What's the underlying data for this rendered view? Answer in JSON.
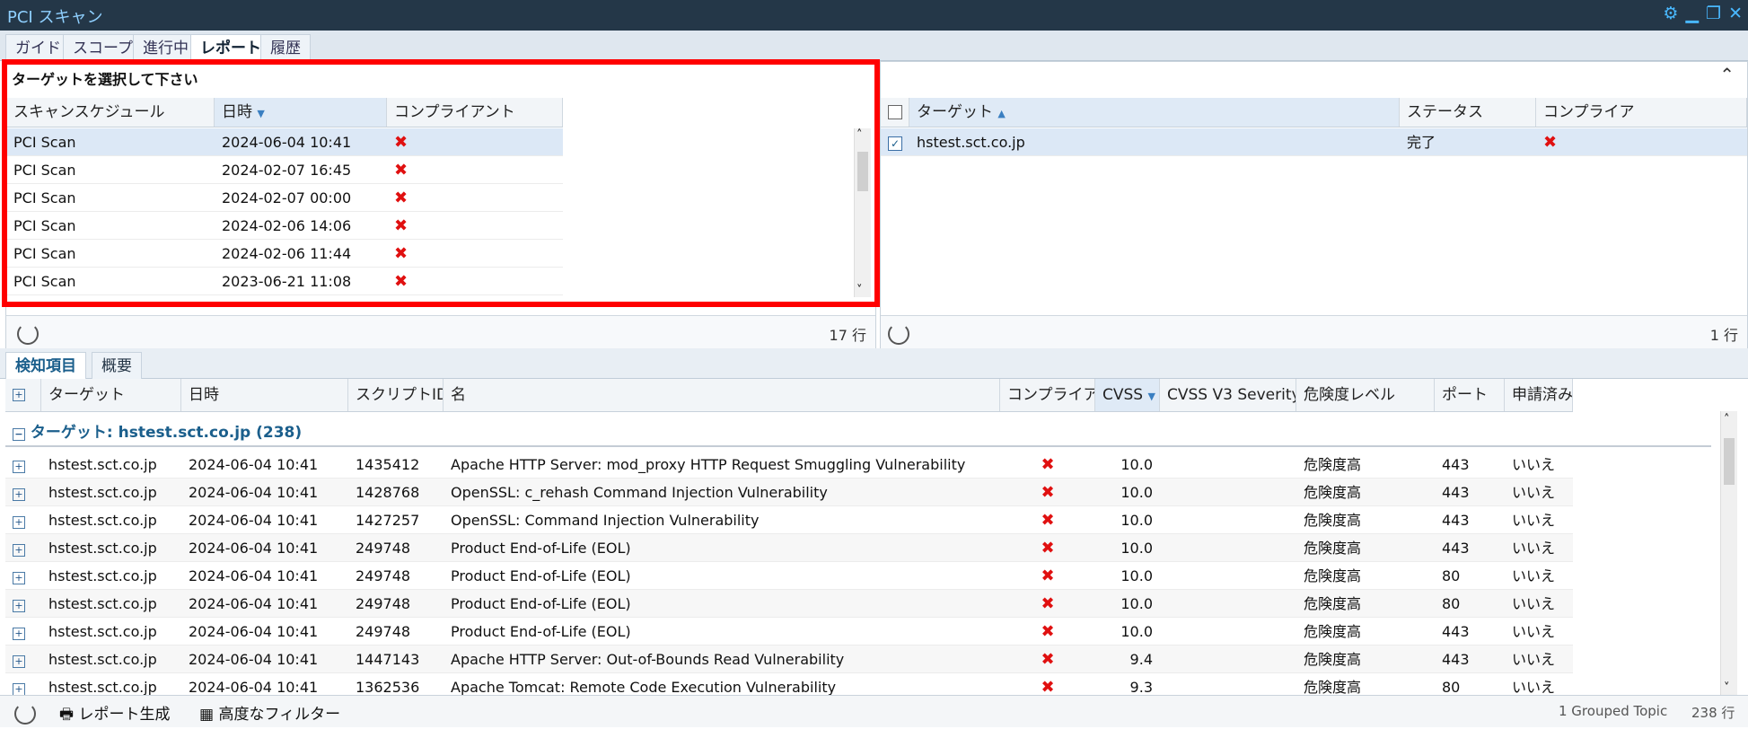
{
  "window": {
    "title": "PCI スキャン",
    "controls": [
      "gear-icon",
      "minimize-icon",
      "restore-icon",
      "close-icon"
    ]
  },
  "main_tabs": [
    "ガイド",
    "スコープ",
    "進行中",
    "レポート",
    "履歴"
  ],
  "active_main_tab": "レポート",
  "left_panel": {
    "title": "ターゲットを選択して下さい",
    "columns": [
      "スキャンスケジュール",
      "日時",
      "コンプライアント"
    ],
    "rows": [
      {
        "schedule": "PCI Scan",
        "datetime": "2024-06-04 10:41",
        "compliant": "✖"
      },
      {
        "schedule": "PCI Scan",
        "datetime": "2024-02-07 16:45",
        "compliant": "✖"
      },
      {
        "schedule": "PCI Scan",
        "datetime": "2024-02-07 00:00",
        "compliant": "✖"
      },
      {
        "schedule": "PCI Scan",
        "datetime": "2024-02-06 14:06",
        "compliant": "✖"
      },
      {
        "schedule": "PCI Scan",
        "datetime": "2024-02-06 11:44",
        "compliant": "✖"
      },
      {
        "schedule": "PCI Scan",
        "datetime": "2023-06-21 11:08",
        "compliant": "✖"
      }
    ],
    "row_count": "17 行"
  },
  "right_panel": {
    "columns": [
      "ターゲット",
      "ステータス",
      "コンプライア"
    ],
    "rows": [
      {
        "target": "hstest.sct.co.jp",
        "status": "完了",
        "compliant": "✖"
      }
    ],
    "row_count": "1 行"
  },
  "sub_tabs": [
    "検知項目",
    "概要"
  ],
  "findings": {
    "columns": [
      "ターゲット",
      "日時",
      "スクリプトID",
      "名",
      "コンプライア",
      "CVSS",
      "CVSS V3 Severity",
      "危険度レベル",
      "ポート",
      "申請済み"
    ],
    "group_label": "ターゲット: hstest.sct.co.jp (238)",
    "rows": [
      {
        "target": "hstest.sct.co.jp",
        "datetime": "2024-06-04 10:41",
        "script_id": "1435412",
        "name": "Apache HTTP Server: mod_proxy HTTP Request Smuggling Vulnerability",
        "compliant": "✖",
        "cvss": "10.0",
        "v3": "",
        "risk": "危険度高",
        "port": "443",
        "applied": "いいえ"
      },
      {
        "target": "hstest.sct.co.jp",
        "datetime": "2024-06-04 10:41",
        "script_id": "1428768",
        "name": "OpenSSL: c_rehash Command Injection Vulnerability",
        "compliant": "✖",
        "cvss": "10.0",
        "v3": "",
        "risk": "危険度高",
        "port": "443",
        "applied": "いいえ"
      },
      {
        "target": "hstest.sct.co.jp",
        "datetime": "2024-06-04 10:41",
        "script_id": "1427257",
        "name": "OpenSSL: Command Injection Vulnerability",
        "compliant": "✖",
        "cvss": "10.0",
        "v3": "",
        "risk": "危険度高",
        "port": "443",
        "applied": "いいえ"
      },
      {
        "target": "hstest.sct.co.jp",
        "datetime": "2024-06-04 10:41",
        "script_id": "249748",
        "name": "Product End-of-Life (EOL)",
        "compliant": "✖",
        "cvss": "10.0",
        "v3": "",
        "risk": "危険度高",
        "port": "443",
        "applied": "いいえ"
      },
      {
        "target": "hstest.sct.co.jp",
        "datetime": "2024-06-04 10:41",
        "script_id": "249748",
        "name": "Product End-of-Life (EOL)",
        "compliant": "✖",
        "cvss": "10.0",
        "v3": "",
        "risk": "危険度高",
        "port": "80",
        "applied": "いいえ"
      },
      {
        "target": "hstest.sct.co.jp",
        "datetime": "2024-06-04 10:41",
        "script_id": "249748",
        "name": "Product End-of-Life (EOL)",
        "compliant": "✖",
        "cvss": "10.0",
        "v3": "",
        "risk": "危険度高",
        "port": "80",
        "applied": "いいえ"
      },
      {
        "target": "hstest.sct.co.jp",
        "datetime": "2024-06-04 10:41",
        "script_id": "249748",
        "name": "Product End-of-Life (EOL)",
        "compliant": "✖",
        "cvss": "10.0",
        "v3": "",
        "risk": "危険度高",
        "port": "443",
        "applied": "いいえ"
      },
      {
        "target": "hstest.sct.co.jp",
        "datetime": "2024-06-04 10:41",
        "script_id": "1447143",
        "name": "Apache HTTP Server: Out-of-Bounds Read Vulnerability",
        "compliant": "✖",
        "cvss": "9.4",
        "v3": "",
        "risk": "危険度高",
        "port": "443",
        "applied": "いいえ"
      },
      {
        "target": "hstest.sct.co.jp",
        "datetime": "2024-06-04 10:41",
        "script_id": "1362536",
        "name": "Apache Tomcat: Remote Code Execution Vulnerability",
        "compliant": "✖",
        "cvss": "9.3",
        "v3": "",
        "risk": "危険度高",
        "port": "80",
        "applied": "いいえ"
      }
    ]
  },
  "footer": {
    "report_button": "レポート生成",
    "filter_button": "高度なフィルター",
    "grouped": "1 Grouped Topic",
    "total": "238 行"
  },
  "colors": {
    "accent_blue": "#1b5f8c",
    "highlight_red": "#ff0000",
    "fail_icon": "#e01010"
  }
}
